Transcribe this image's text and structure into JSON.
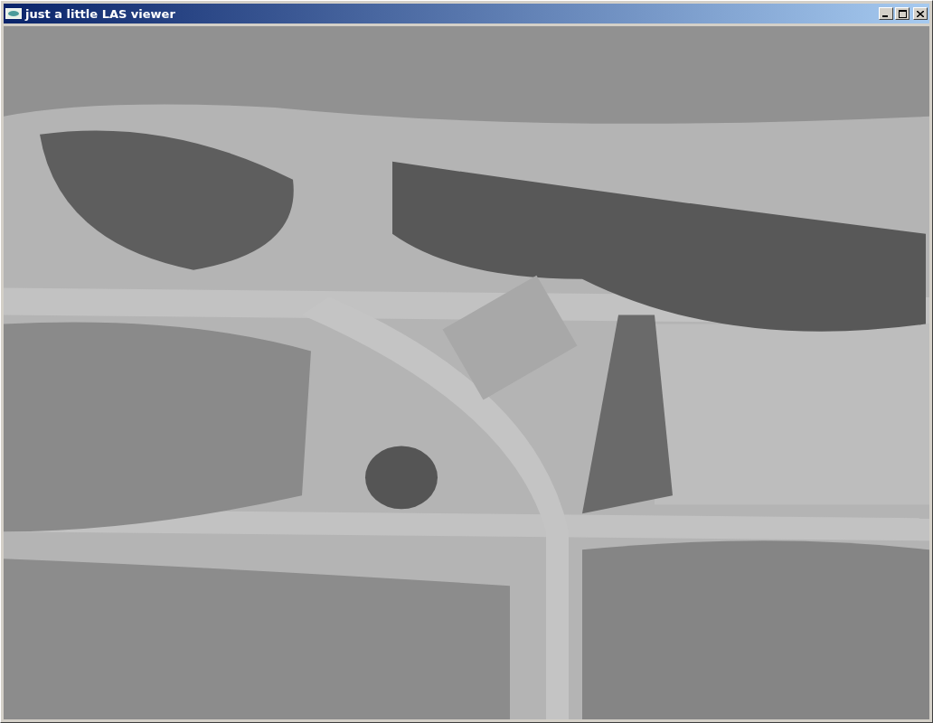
{
  "window": {
    "title": "just a little LAS viewer"
  }
}
